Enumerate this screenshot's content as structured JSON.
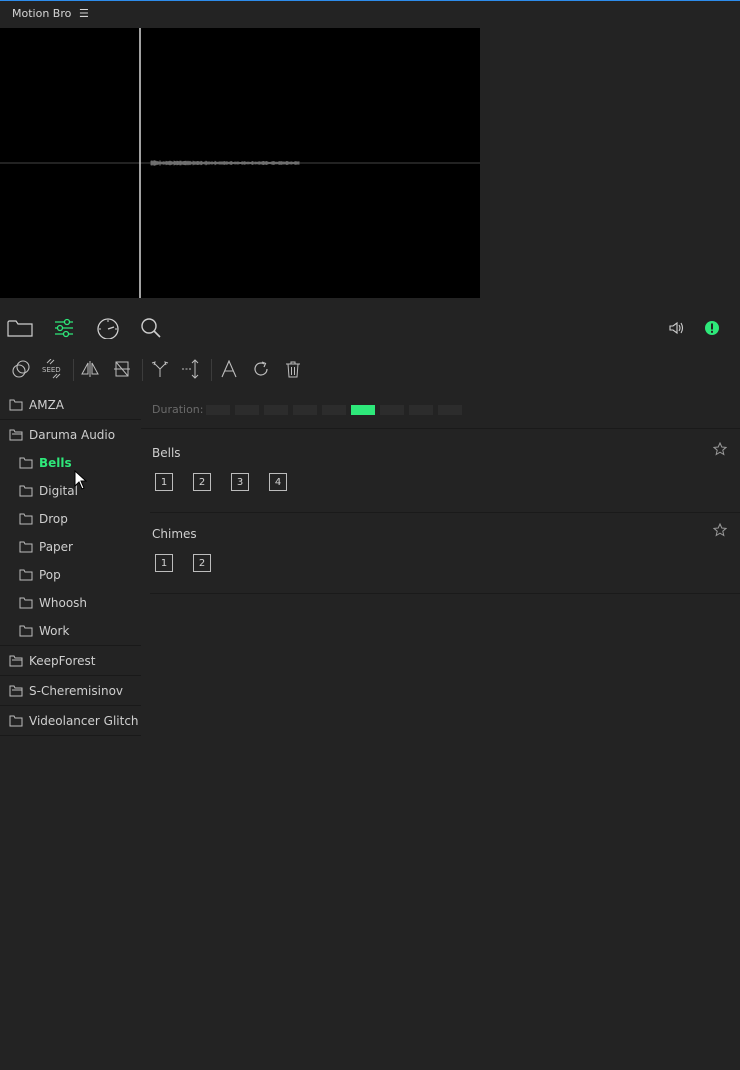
{
  "app": {
    "title": "Motion Bro"
  },
  "icons": {
    "menu": "menu-icon",
    "folder": "folder-icon",
    "sliders": "sliders-icon",
    "gauge": "gauge-icon",
    "search": "search-icon",
    "volume": "volume-icon",
    "alert": "alert-icon"
  },
  "colors": {
    "accent": "#2ee87a",
    "background": "#232323"
  },
  "tree": {
    "items": [
      {
        "label": "AMZA"
      },
      {
        "label": "Daruma Audio"
      },
      {
        "label": "Bells"
      },
      {
        "label": "Digital"
      },
      {
        "label": "Drop"
      },
      {
        "label": "Paper"
      },
      {
        "label": "Pop"
      },
      {
        "label": "Whoosh"
      },
      {
        "label": "Work"
      },
      {
        "label": "KeepForest"
      },
      {
        "label": "S-Cheremisinov"
      },
      {
        "label": "Videolancer Glitch"
      }
    ]
  },
  "content": {
    "duration_label": "Duration:",
    "duration_selected": 6,
    "duration_count": 9,
    "groups": [
      {
        "title": "Bells",
        "buttons": [
          "1",
          "2",
          "3",
          "4"
        ]
      },
      {
        "title": "Chimes",
        "buttons": [
          "1",
          "2"
        ]
      }
    ]
  }
}
